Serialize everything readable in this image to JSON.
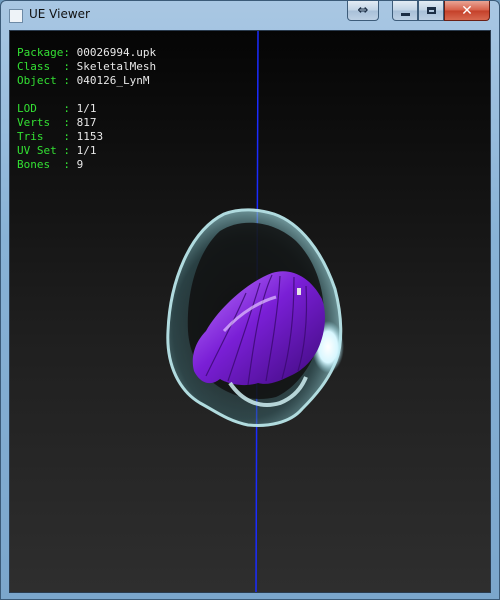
{
  "window": {
    "title": "UE Viewer",
    "buttons": {
      "swap_icon": "double-arrow-icon",
      "swap_glyph": "⇔",
      "minimize_icon": "minimize-icon",
      "maximize_icon": "maximize-icon",
      "close_icon": "close-icon",
      "close_glyph": "✕"
    }
  },
  "info": {
    "package": {
      "label": "Package:",
      "value": "00026994.upk"
    },
    "class": {
      "label": "Class  :",
      "value": "SkeletalMesh"
    },
    "object": {
      "label": "Object :",
      "value": "040126_LynM"
    },
    "lod": {
      "label": "LOD    :",
      "value": "1/1"
    },
    "verts": {
      "label": "Verts  :",
      "value": "817"
    },
    "tris": {
      "label": "Tris   :",
      "value": "1153"
    },
    "uvset": {
      "label": "UV Set :",
      "value": "1/1"
    },
    "bones": {
      "label": "Bones  :",
      "value": "9"
    }
  },
  "colors": {
    "label_green": "#33e033",
    "value_white": "#e8e8e8",
    "axis_blue": "#1a2bff",
    "hair_purple": "#7a1fd6",
    "shell_cyan": "#8fc9cf"
  }
}
